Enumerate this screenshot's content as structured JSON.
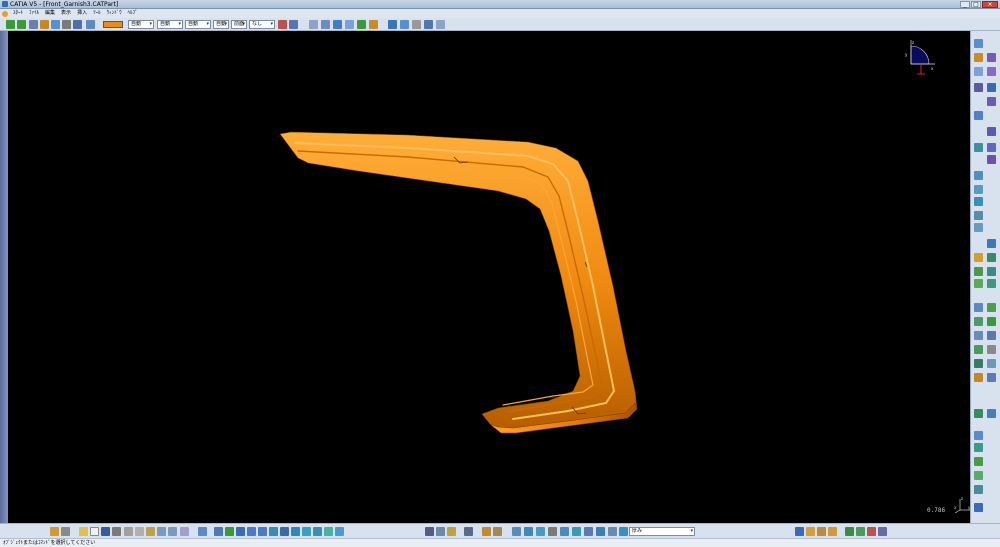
{
  "window": {
    "title": "CATIA V5 - [Front_Garnish3.CATPart]",
    "controls": [
      "_",
      "□",
      "×"
    ]
  },
  "menubar": {
    "items": [
      "ｽﾀｰﾄ",
      "ﾌｧｲﾙ",
      "編集",
      "表示",
      "挿入",
      "ﾂｰﾙ",
      "ｳｨﾝﾄﾞｳ",
      "ﾍﾙﾌﾟ"
    ]
  },
  "toolbar": {
    "color": "#f08a10",
    "transparency_value": "自動",
    "line_type_value": "自動",
    "line_weight_value": "自動",
    "layer_value": "自動",
    "point_style_value": "前面",
    "render_style_value": "なし"
  },
  "viewport": {
    "background": "#000000",
    "part_color": "#f08a10",
    "zoom_readout": "0.786",
    "compass_labels": {
      "x": "x",
      "y": "y",
      "z": "z"
    },
    "axis_labels": {
      "x": "x",
      "y": "y",
      "z": "z"
    }
  },
  "bottom_toolbar": {
    "select_value": "厚み"
  },
  "status": {
    "prompt": "ｵﾌﾞｼﾞｪｸﾄまたはｺﾏﾝﾄﾞを選択してください"
  },
  "icons": {
    "top": [
      "select-arrow-icon",
      "move-icon",
      "snap-icon",
      "pen-icon",
      "fly-icon",
      "rotate-icon",
      "filter-icon",
      "paint-icon",
      "dress-icon",
      "plane-icon",
      "sketch-icon",
      "analysis-icon"
    ],
    "right": [
      "sketcher-icon",
      "plane-icon",
      "extrude-icon",
      "surface-icon",
      "fillet-icon",
      "sweep-icon",
      "line-icon",
      "circle-icon",
      "spline-icon",
      "measure-icon",
      "catalog-icon",
      "analysis-icon"
    ],
    "bottom": [
      "folder-icon",
      "new-icon",
      "save-icon",
      "print-icon",
      "undo-icon",
      "redo-icon",
      "pan-icon",
      "rotate-icon",
      "zoom-in-icon",
      "zoom-out-icon",
      "normal-view-icon",
      "fit-all-icon"
    ]
  },
  "ui_colors": {
    "chrome": "#d8e2ee",
    "title_gradient": "#a9bed8",
    "accent_blue": "#2f6fb5",
    "accent_orange": "#f29b1d"
  }
}
